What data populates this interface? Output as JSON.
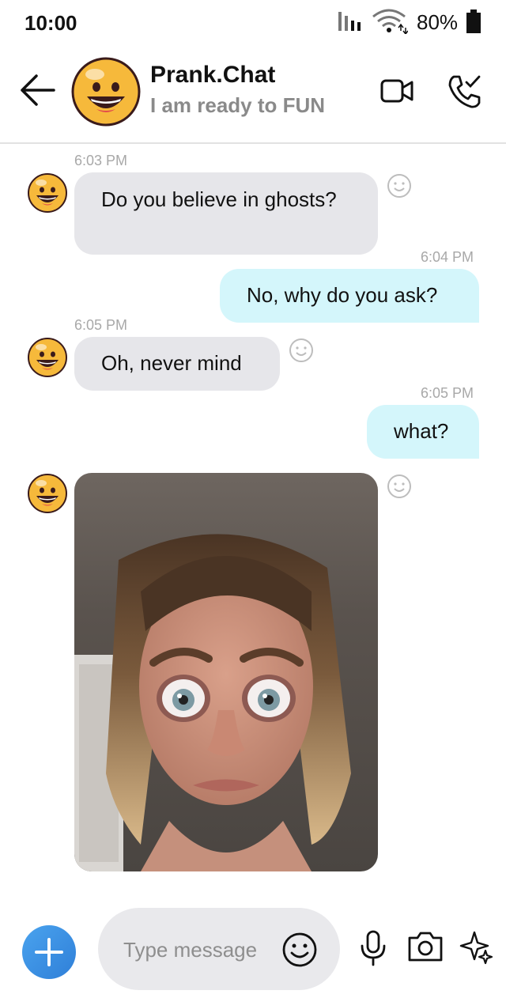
{
  "status_bar": {
    "time": "10:00",
    "battery": "80%"
  },
  "header": {
    "title": "Prank.Chat",
    "subtitle": "I am ready to FUN"
  },
  "messages": [
    {
      "time": "6:03 PM",
      "text": "Do you believe in ghosts?"
    },
    {
      "time": "6:04 PM",
      "text": "No, why do you ask?"
    },
    {
      "time": "6:05 PM",
      "text": "Oh, never mind"
    },
    {
      "time": "6:05 PM",
      "text": "what?"
    }
  ],
  "composer": {
    "placeholder": "Type message"
  },
  "colors": {
    "accent": "#2f7fd8",
    "incoming_bubble": "#e6e6ea",
    "outgoing_bubble": "#d4f6fb",
    "avatar": "#f6b93b"
  }
}
